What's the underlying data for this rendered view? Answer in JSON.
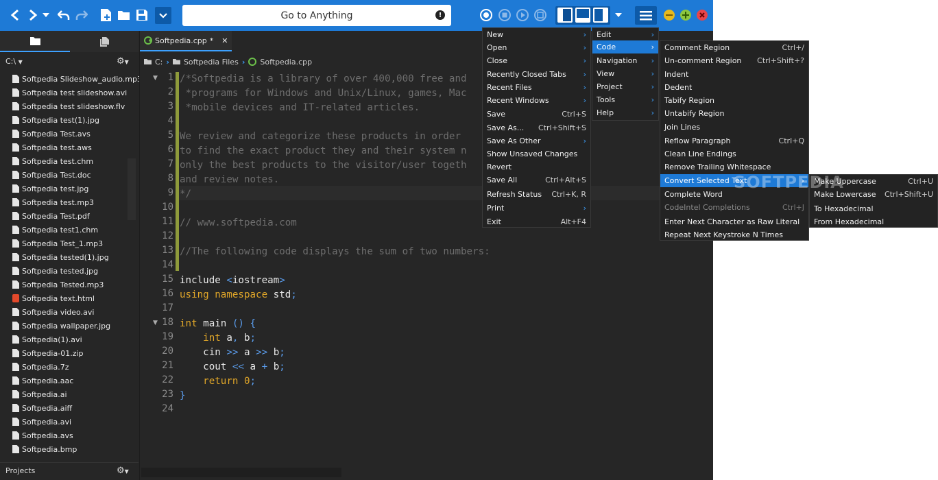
{
  "toolbar": {
    "goto_placeholder": "Go to Anything",
    "icons": [
      "back-icon",
      "forward-icon",
      "dropdown-icon",
      "undo-icon",
      "redo-icon",
      "new-file-icon",
      "open-folder-icon",
      "save-icon",
      "more-icon",
      "record-macro-icon",
      "stop-macro-icon",
      "play-macro-icon",
      "save-macro-icon",
      "layout-left-icon",
      "layout-bottom-icon",
      "layout-right-icon",
      "hamburger-icon",
      "minimize-icon",
      "maximize-icon",
      "close-icon"
    ]
  },
  "left_pane": {
    "path": "C:\\",
    "files": [
      {
        "name": "Softpedia Slideshow_audio.mp3",
        "type": "file"
      },
      {
        "name": "Softpedia test slideshow.avi",
        "type": "file"
      },
      {
        "name": "Softpedia test slideshow.flv",
        "type": "file"
      },
      {
        "name": "Softpedia test(1).jpg",
        "type": "file"
      },
      {
        "name": "Softpedia Test.avs",
        "type": "file"
      },
      {
        "name": "Softpedia test.aws",
        "type": "file"
      },
      {
        "name": "Softpedia test.chm",
        "type": "file"
      },
      {
        "name": "Softpedia Test.doc",
        "type": "file"
      },
      {
        "name": "Softpedia test.jpg",
        "type": "file"
      },
      {
        "name": "Softpedia test.mp3",
        "type": "file"
      },
      {
        "name": "Softpedia Test.pdf",
        "type": "file"
      },
      {
        "name": "Softpedia test1.chm",
        "type": "file"
      },
      {
        "name": "Softpedia Test_1.mp3",
        "type": "file"
      },
      {
        "name": "Softpedia tested(1).jpg",
        "type": "file"
      },
      {
        "name": "Softpedia tested.jpg",
        "type": "file"
      },
      {
        "name": "Softpedia Tested.mp3",
        "type": "file"
      },
      {
        "name": "Softpedia text.html",
        "type": "html"
      },
      {
        "name": "Softpedia video.avi",
        "type": "file"
      },
      {
        "name": "Softpedia wallpaper.jpg",
        "type": "file"
      },
      {
        "name": "Softpedia(1).avi",
        "type": "file"
      },
      {
        "name": "Softpedia-01.zip",
        "type": "file"
      },
      {
        "name": "Softpedia.7z",
        "type": "file"
      },
      {
        "name": "Softpedia.aac",
        "type": "file"
      },
      {
        "name": "Softpedia.ai",
        "type": "file"
      },
      {
        "name": "Softpedia.aiff",
        "type": "file"
      },
      {
        "name": "Softpedia.avi",
        "type": "file"
      },
      {
        "name": "Softpedia.avs",
        "type": "file"
      },
      {
        "name": "Softpedia.bmp",
        "type": "file"
      }
    ],
    "projects_label": "Projects"
  },
  "editor": {
    "tab_label": "Softpedia.cpp",
    "tab_modified": "*",
    "breadcrumb": [
      "C:",
      "Softpedia Files",
      "Softpedia.cpp"
    ],
    "lines": [
      [
        [
          "cm",
          "/*Softpedia is a library of over 400,000 free and"
        ]
      ],
      [
        [
          "cm",
          " *programs for Windows and Unix/Linux, games, Mac"
        ]
      ],
      [
        [
          "cm",
          " *mobile devices and IT-related articles."
        ]
      ],
      [],
      [
        [
          "cm",
          "We review and categorize these products in order"
        ]
      ],
      [
        [
          "cm",
          "to find the exact product they and their system n"
        ]
      ],
      [
        [
          "cm",
          "only the best products to the visitor/user togeth"
        ]
      ],
      [
        [
          "cm",
          "and review notes."
        ]
      ],
      [
        [
          "cm",
          "*/"
        ]
      ],
      [],
      [
        [
          "cm",
          "// www.softpedia.com"
        ]
      ],
      [],
      [
        [
          "cm",
          "//The following code displays the sum of two numbers:"
        ]
      ],
      [],
      [
        [
          "id",
          "include "
        ],
        [
          "op",
          "<"
        ],
        [
          "id",
          "iostream"
        ],
        [
          "op",
          ">"
        ]
      ],
      [
        [
          "kw",
          "using namespace "
        ],
        [
          "id",
          "std"
        ],
        [
          "op",
          ";"
        ]
      ],
      [],
      [
        [
          "kw",
          "int "
        ],
        [
          "id",
          "main "
        ],
        [
          "op",
          "() {"
        ]
      ],
      [
        [
          "id",
          "    "
        ],
        [
          "kw",
          "int "
        ],
        [
          "id",
          "a"
        ],
        [
          "op",
          ", "
        ],
        [
          "id",
          "b"
        ],
        [
          "op",
          ";"
        ]
      ],
      [
        [
          "id",
          "    cin "
        ],
        [
          "op",
          ">> "
        ],
        [
          "id",
          "a "
        ],
        [
          "op",
          ">> "
        ],
        [
          "id",
          "b"
        ],
        [
          "op",
          ";"
        ]
      ],
      [
        [
          "id",
          "    cout "
        ],
        [
          "op",
          "<< "
        ],
        [
          "id",
          "a "
        ],
        [
          "op",
          "+ "
        ],
        [
          "id",
          "b"
        ],
        [
          "op",
          ";"
        ]
      ],
      [
        [
          "id",
          "    "
        ],
        [
          "kw",
          "return "
        ],
        [
          "kw",
          "0"
        ],
        [
          "op",
          ";"
        ]
      ],
      [
        [
          "op",
          "}"
        ]
      ],
      []
    ],
    "fold_lines": [
      1,
      18
    ]
  },
  "menus": {
    "file": [
      {
        "label": "New",
        "arrow": true
      },
      {
        "label": "Open",
        "arrow": true
      },
      {
        "label": "Close",
        "arrow": true
      },
      {
        "label": "Recently Closed Tabs",
        "arrow": true
      },
      {
        "label": "Recent Files",
        "arrow": true
      },
      {
        "label": "Recent Windows",
        "arrow": true
      },
      {
        "label": "Save",
        "shortcut": "Ctrl+S"
      },
      {
        "label": "Save As...",
        "shortcut": "Ctrl+Shift+S"
      },
      {
        "label": "Save As Other",
        "arrow": true
      },
      {
        "label": "Show Unsaved Changes"
      },
      {
        "label": "Revert"
      },
      {
        "label": "Save All",
        "shortcut": "Ctrl+Alt+S"
      },
      {
        "label": "Refresh Status",
        "shortcut": "Ctrl+K, R"
      },
      {
        "label": "Print",
        "arrow": true
      },
      {
        "label": "Exit",
        "shortcut": "Alt+F4"
      }
    ],
    "main": [
      {
        "label": "Edit",
        "arrow": true
      },
      {
        "label": "Code",
        "arrow": true,
        "highlight": true
      },
      {
        "label": "Navigation",
        "arrow": true
      },
      {
        "label": "View",
        "arrow": true
      },
      {
        "label": "Project",
        "arrow": true
      },
      {
        "label": "Tools",
        "arrow": true
      },
      {
        "label": "Help",
        "arrow": true
      }
    ],
    "code": [
      {
        "label": "Comment Region",
        "shortcut": "Ctrl+/"
      },
      {
        "label": "Un-comment Region",
        "shortcut": "Ctrl+Shift+?"
      },
      {
        "label": "Indent"
      },
      {
        "label": "Dedent"
      },
      {
        "label": "Tabify Region"
      },
      {
        "label": "Untabify Region"
      },
      {
        "label": "Join Lines"
      },
      {
        "label": "Reflow Paragraph",
        "shortcut": "Ctrl+Q"
      },
      {
        "label": "Clean Line Endings"
      },
      {
        "label": "Remove Trailing Whitespace"
      },
      {
        "label": "Convert Selected Text",
        "arrow": true,
        "highlight": true
      },
      {
        "label": "Complete Word"
      },
      {
        "label": "CodeIntel Completions",
        "shortcut": "Ctrl+J",
        "disabled": true
      },
      {
        "label": "Enter Next Character as Raw Literal"
      },
      {
        "label": "Repeat Next Keystroke N Times"
      }
    ],
    "convert": [
      {
        "label": "Make Uppercase",
        "shortcut": "Ctrl+U"
      },
      {
        "label": "Make Lowercase",
        "shortcut": "Ctrl+Shift+U"
      },
      {
        "label": "To Hexadecimal"
      },
      {
        "label": "From Hexadecimal"
      }
    ]
  },
  "watermark": "SOFTPEDIA"
}
